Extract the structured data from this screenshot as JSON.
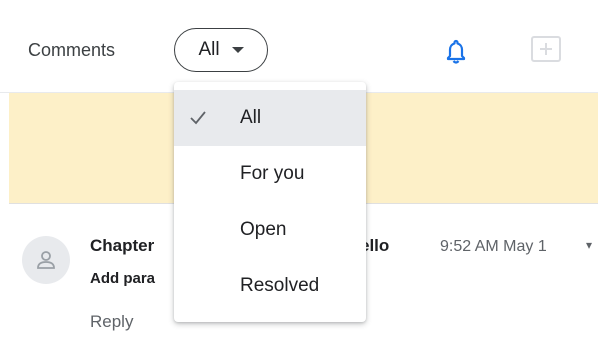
{
  "header": {
    "title": "Comments",
    "filter_value": "All"
  },
  "menu": {
    "items": [
      {
        "label": "All",
        "selected": true
      },
      {
        "label": "For you",
        "selected": false
      },
      {
        "label": "Open",
        "selected": false
      },
      {
        "label": "Resolved",
        "selected": false
      }
    ]
  },
  "comment": {
    "title_visible_left": "Chapter",
    "title_visible_right": "ello",
    "time": "9:52 AM May 1",
    "subtitle_visible": "Add para",
    "reply_label": "Reply"
  },
  "colors": {
    "accent": "#1a73e8",
    "banner": "#fdf0c8",
    "selected_bg": "#e8eaed"
  },
  "icons": {
    "bell": "bell-icon",
    "add_comment": "add-comment-icon",
    "caret": "caret-down-icon",
    "check": "check-icon",
    "avatar": "person-icon"
  }
}
